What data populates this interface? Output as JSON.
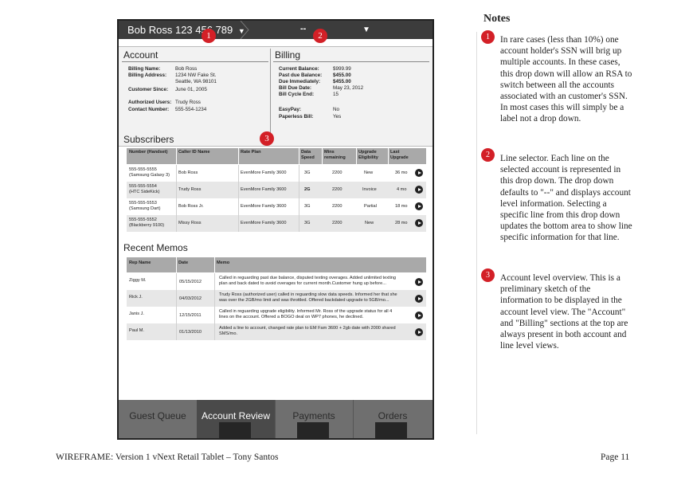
{
  "header": {
    "account_selector": "Bob Ross 123 456 789",
    "line_selector": "--",
    "caret": "▼"
  },
  "account": {
    "title": "Account",
    "billing_name_label": "Billing Name:",
    "billing_name": "Bob Ross",
    "billing_address_label": "Billing Address:",
    "billing_address_1": "1234 NW Fake St.",
    "billing_address_2": "Seattle, WA 98101",
    "customer_since_label": "Customer Since:",
    "customer_since": "June 01, 2005",
    "authorized_users_label": "Authorized Users:",
    "authorized_users": "Trudy Ross",
    "contact_number_label": "Contact Number:",
    "contact_number": "555-554-1234"
  },
  "billing": {
    "title": "Billing",
    "current_balance_label": "Current Balance:",
    "current_balance": "$999.99",
    "past_due_label": "Past due Balance:",
    "past_due": "$455.00",
    "due_immediately_label": "Due Immediately:",
    "due_immediately": "$455.00",
    "bill_due_date_label": "Bill Due Date:",
    "bill_due_date": "May 23, 2012",
    "bill_cycle_end_label": "Bill Cycle End:",
    "bill_cycle_end": "15",
    "easypay_label": "EasyPay:",
    "easypay": "No",
    "paperless_label": "Paperless Bill:",
    "paperless": "Yes"
  },
  "subscribers": {
    "title": "Subscribers",
    "columns": [
      "Number (Handset)",
      "Caller ID Name",
      "Rate Plan",
      "Data Speed",
      "Mins remaining",
      "Upgrade Eligibility",
      "Last Upgrade"
    ],
    "rows": [
      {
        "number": "555-555-5555",
        "handset": "(Samsung Galaxy 3)",
        "caller": "Bob Ross",
        "plan": "EvenMore Family 3600",
        "speed": "3G",
        "mins": "2200",
        "upgrade": "New",
        "last": "36 mo"
      },
      {
        "number": "555-555-5554",
        "handset": "(HTC SideKick)",
        "caller": "Trudy Ross",
        "plan": "EvenMore Family 3600",
        "speed": "2G",
        "mins": "2200",
        "upgrade": "Invoice",
        "last": "4 mo"
      },
      {
        "number": "555-555-5553",
        "handset": "(Samsung Dart)",
        "caller": "Bob Ross Jr.",
        "plan": "EvenMore Family 3600",
        "speed": "3G",
        "mins": "2200",
        "upgrade": "Partial",
        "last": "18 mo"
      },
      {
        "number": "555-555-5552",
        "handset": "(Blackberry 9100)",
        "caller": "Missy Ross",
        "plan": "EvenMore Family 3600",
        "speed": "3G",
        "mins": "2200",
        "upgrade": "New",
        "last": "28 mo"
      }
    ]
  },
  "memos": {
    "title": "Recent Memos",
    "columns": [
      "Rep Name",
      "Date",
      "Memo"
    ],
    "rows": [
      {
        "rep": "Ziggy M.",
        "date": "05/15/2012",
        "memo1": "Called in reguarding past due balance, disputed texting overages. Added unlimited texting",
        "memo2": "plan and back dated to avoid overages for current month.Customer hung up before..."
      },
      {
        "rep": "Rick J.",
        "date": "04/03/2012",
        "memo1": "Trudy Ross (authorized user) called in reguarding slow data speeds. Informed her that she",
        "memo2": "was over the 2GB/mo limit and was throttled. Offered backdated upgrade to 5GB/mo..."
      },
      {
        "rep": "Janis J.",
        "date": "12/15/2011",
        "memo1": "Called in reguarding upgrade eligibility. Informed Mr. Ross of the upgrade status for all 4",
        "memo2": "lines on the account. Offered a BOGO deal on WP7 phones, he declined."
      },
      {
        "rep": "Paul M.",
        "date": "01/13/2010",
        "memo1": "Added a line to account, changed rate plan to EM Fam 3600 + 2gb date with 2000 shared",
        "memo2": "SMS/mo."
      }
    ]
  },
  "nav": {
    "tabs": [
      "Guest Queue",
      "Account Review",
      "Payments",
      "Orders"
    ],
    "active": "Account Review"
  },
  "notes": {
    "title": "Notes",
    "items": [
      {
        "num": "1",
        "text": "In rare cases (less than 10%) one account holder's SSN will brig up multiple accounts. In these cases, this drop down will allow an RSA to switch between all the accounts associated with an customer's SSN. In most cases this will simply be a label not a drop down."
      },
      {
        "num": "2",
        "text": "Line selector. Each line on the selected account is represented in this drop down. The drop down defaults to \"--\" and displays account level information. Selecting a specific line from this drop down updates the bottom area to show line specific information for that line."
      },
      {
        "num": "3",
        "text": "Account level overview. This is a preliminary sketch of the information to be displayed in the account level view. The \"Account\" and \"Billing\" sections at the top are always present in both account and line level views."
      }
    ]
  },
  "footer": {
    "left": "WIREFRAME: Version 1 vNext Retail Tablet – Tony Santos",
    "right": "Page 11"
  },
  "colors": {
    "badge": "#d32027",
    "topbar": "#3c3c3c",
    "nav": "#6f6f6f",
    "nav_active": "#4a4a4a"
  }
}
